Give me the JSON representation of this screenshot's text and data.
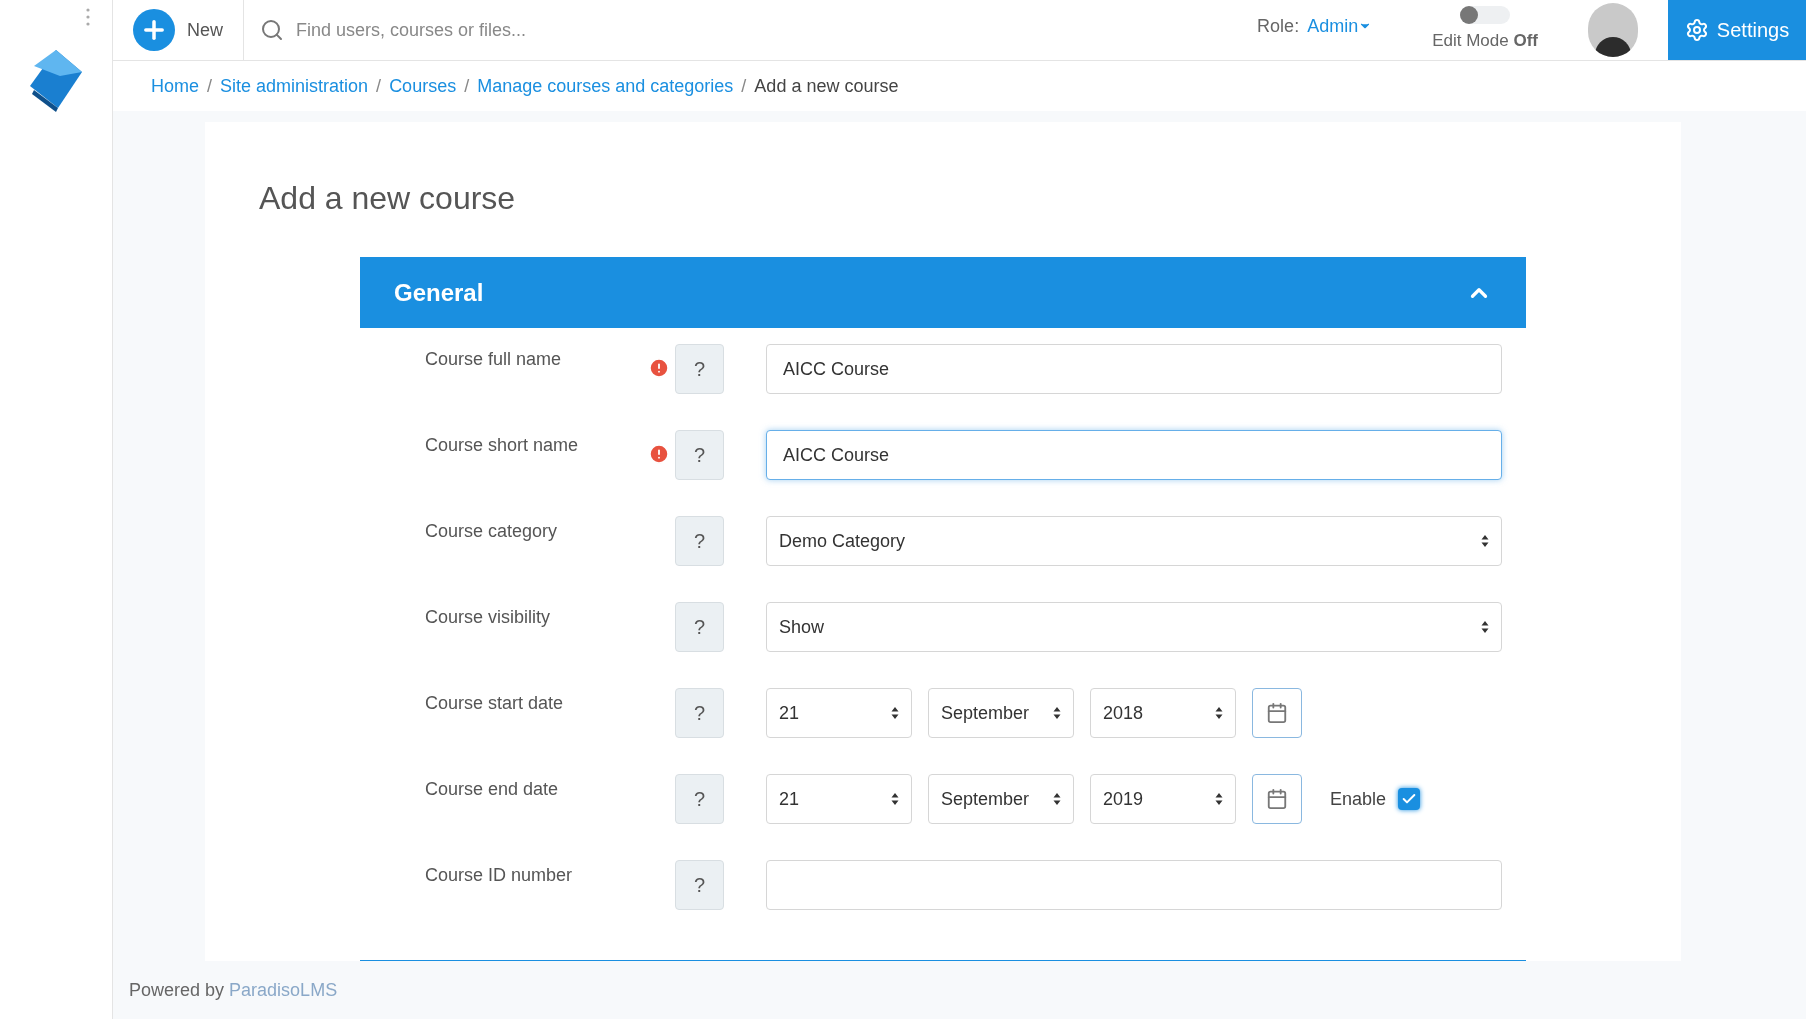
{
  "topbar": {
    "new_label": "New",
    "search": {
      "placeholder": "Find users, courses or files..."
    },
    "role_label": "Role:",
    "role_value": "Admin",
    "edit_mode": {
      "label": "Edit Mode",
      "state_text": "Off",
      "on": false
    },
    "settings_label": "Settings"
  },
  "breadcrumb": [
    {
      "label": "Home",
      "link": true
    },
    {
      "separator": "/",
      "label": "Site administration",
      "link": true
    },
    {
      "separator": "/",
      "label": "Courses",
      "link": true
    },
    {
      "separator": "/",
      "label": "Manage courses and categories",
      "link": true
    },
    {
      "separator": "/",
      "label": "Add a new course",
      "link": false
    }
  ],
  "page_title": "Add a new course",
  "section": {
    "title": "General",
    "expanded": true
  },
  "fields": [
    {
      "kind": "text",
      "label": "Course full name",
      "required": true,
      "value": "AICC Course",
      "focused": false
    },
    {
      "kind": "text",
      "label": "Course short name",
      "required": true,
      "value": "AICC Course",
      "focused": true
    },
    {
      "kind": "select",
      "label": "Course category",
      "required": false,
      "value": "Demo Category"
    },
    {
      "kind": "select",
      "label": "Course visibility",
      "required": false,
      "value": "Show"
    },
    {
      "kind": "date",
      "label": "Course start date",
      "required": false,
      "day": "21",
      "month": "September",
      "year": "2018"
    },
    {
      "kind": "date",
      "label": "Course end date",
      "required": false,
      "day": "21",
      "month": "September",
      "year": "2019",
      "enable": {
        "label": "Enable",
        "checked": true
      }
    },
    {
      "kind": "text",
      "label": "Course ID number",
      "required": false,
      "focused": false
    }
  ],
  "help_mark": "?",
  "footer": {
    "text": "Powered by",
    "link": "ParadisoLMS"
  }
}
